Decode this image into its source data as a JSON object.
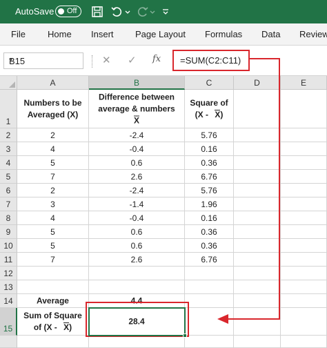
{
  "titlebar": {
    "autosave_label": "AutoSave",
    "toggle_state": "Off"
  },
  "ribbon": {
    "tabs": [
      "File",
      "Home",
      "Insert",
      "Page Layout",
      "Formulas",
      "Data",
      "Review"
    ]
  },
  "formula_bar": {
    "name_box": "B15",
    "fx_label": "fx",
    "formula": "=SUM(C2:C11)"
  },
  "columns": [
    "A",
    "B",
    "C",
    "D",
    "E"
  ],
  "rows": [
    "1",
    "2",
    "3",
    "4",
    "5",
    "6",
    "7",
    "8",
    "9",
    "10",
    "11",
    "12",
    "13",
    "14",
    "15"
  ],
  "headers": {
    "a1": "Numbers to be Averaged (X)",
    "b1": "Difference between average & numbers",
    "b1_symbol": "X",
    "c1": "Square of",
    "c1_formula_prefix": "(X -",
    "c1_symbol": "X",
    "c1_close": ")"
  },
  "table": [
    {
      "x": "2",
      "diff": "-2.4",
      "sq": "5.76"
    },
    {
      "x": "4",
      "diff": "-0.4",
      "sq": "0.16"
    },
    {
      "x": "5",
      "diff": "0.6",
      "sq": "0.36"
    },
    {
      "x": "7",
      "diff": "2.6",
      "sq": "6.76"
    },
    {
      "x": "2",
      "diff": "-2.4",
      "sq": "5.76"
    },
    {
      "x": "3",
      "diff": "-1.4",
      "sq": "1.96"
    },
    {
      "x": "4",
      "diff": "-0.4",
      "sq": "0.16"
    },
    {
      "x": "5",
      "diff": "0.6",
      "sq": "0.36"
    },
    {
      "x": "5",
      "diff": "0.6",
      "sq": "0.36"
    },
    {
      "x": "7",
      "diff": "2.6",
      "sq": "6.76"
    }
  ],
  "average": {
    "label": "Average",
    "value": "4.4"
  },
  "sum_squares": {
    "label_line1": "Sum of Square",
    "label_prefix": "of (X -",
    "label_symbol": "X",
    "label_close": ")",
    "value": "28.4"
  },
  "colors": {
    "excel_green": "#217346",
    "highlight_red": "#d9262c"
  }
}
